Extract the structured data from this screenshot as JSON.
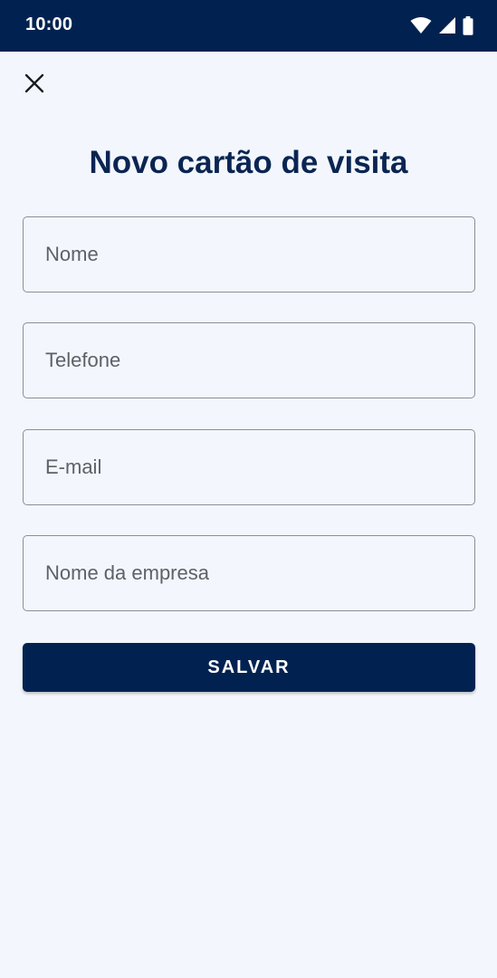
{
  "status_bar": {
    "time": "10:00",
    "icons": [
      "wifi-icon",
      "signal-icon",
      "battery-icon"
    ],
    "background": "#012250"
  },
  "header": {
    "close_icon": "close-icon",
    "title": "Novo cartão de visita"
  },
  "form": {
    "name_placeholder": "Nome",
    "phone_placeholder": "Telefone",
    "email_placeholder": "E-mail",
    "company_placeholder": "Nome da empresa",
    "save_label": "SALVAR"
  },
  "colors": {
    "accent": "#012250",
    "title": "#0b2553",
    "background": "#f3f7fd",
    "field_border": "#8a8f97"
  }
}
